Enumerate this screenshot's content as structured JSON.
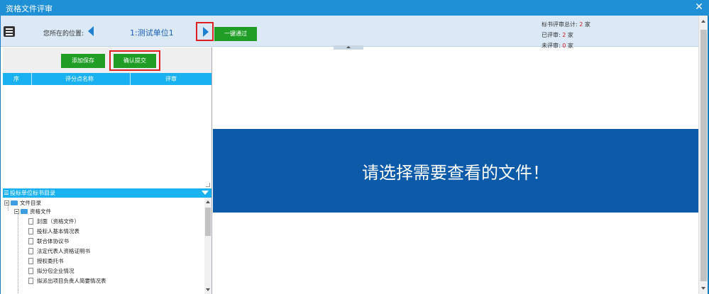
{
  "window": {
    "title": "资格文件评审",
    "close_glyph": "✕"
  },
  "topbar": {
    "location_label": "您所在的位置:",
    "unit_name": "1:测试单位1",
    "pass_all_label": "一键通过",
    "stats": {
      "total_label": "标书评审总计:",
      "total_value": "2",
      "reviewed_label": "已评审:",
      "reviewed_value": "2",
      "unreviewed_label": "未评审:",
      "unreviewed_value": "0",
      "unit": "家"
    }
  },
  "leftpanel": {
    "add_save_label": "添加保存",
    "confirm_submit_label": "确认提交",
    "table_headers": [
      "序",
      "评分点名称",
      "评审"
    ],
    "tree_title": "投标单位标书目录",
    "tree": {
      "root": "文件目录",
      "folder": "资格文件",
      "items": [
        "封面（资格文件）",
        "投标人基本情况表",
        "联合体协议书",
        "法定代表人资格证明书",
        "授权委托书",
        "拟分包企业情况",
        "拟派出项目负责人简要情况表"
      ]
    }
  },
  "viewer": {
    "message": "请选择需要查看的文件！"
  }
}
